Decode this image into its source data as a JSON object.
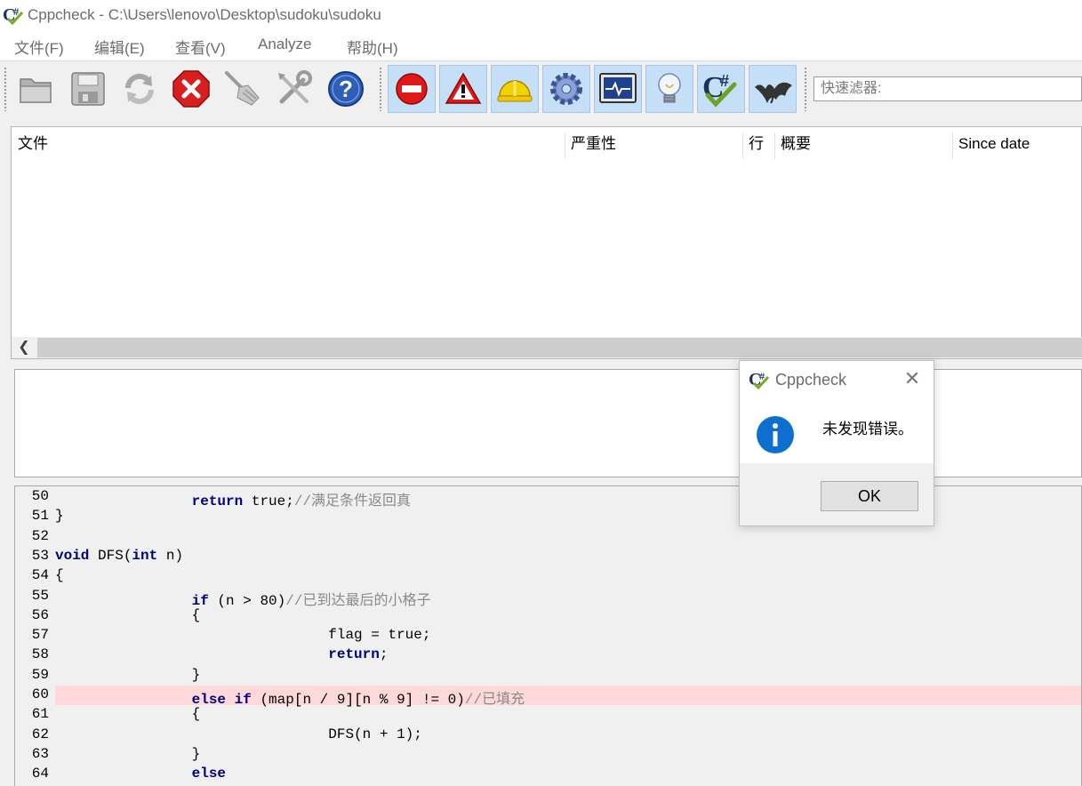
{
  "window": {
    "title": "Cppcheck - C:\\Users\\lenovo\\Desktop\\sudoku\\sudoku",
    "icon": "cppcheck-logo-icon"
  },
  "menu": [
    {
      "label": "文件(F)"
    },
    {
      "label": "编辑(E)"
    },
    {
      "label": "查看(V)"
    },
    {
      "label": "Analyze"
    },
    {
      "label": "帮助(H)"
    }
  ],
  "toolbar": {
    "buttons": [
      {
        "icon": "open-folder-icon"
      },
      {
        "icon": "save-icon"
      },
      {
        "icon": "refresh-icon"
      },
      {
        "icon": "stop-icon"
      },
      {
        "icon": "clear-broom-icon"
      },
      {
        "icon": "tools-icon"
      },
      {
        "icon": "help-icon"
      }
    ],
    "filters": [
      {
        "icon": "error-filter-icon"
      },
      {
        "icon": "warning-filter-icon"
      },
      {
        "icon": "style-filter-icon"
      },
      {
        "icon": "performance-filter-icon"
      },
      {
        "icon": "portability-filter-icon"
      },
      {
        "icon": "information-filter-icon"
      },
      {
        "icon": "cpp-standard-filter-icon"
      },
      {
        "icon": "unused-filter-icon"
      }
    ],
    "filter_placeholder": "快速滤器:"
  },
  "results": {
    "columns": [
      "文件",
      "严重性",
      "行",
      "概要",
      "Since date"
    ]
  },
  "code": {
    "lines": [
      {
        "num": "50",
        "indent": "                ",
        "parts": [
          {
            "t": "return",
            "c": "kw"
          },
          {
            "t": " true;"
          },
          {
            "t": "//满足条件返回真",
            "c": "cm"
          }
        ]
      },
      {
        "num": "51",
        "indent": "",
        "parts": [
          {
            "t": "}"
          }
        ]
      },
      {
        "num": "52",
        "indent": "",
        "parts": []
      },
      {
        "num": "53",
        "indent": "",
        "parts": [
          {
            "t": "void",
            "c": "kw"
          },
          {
            "t": " DFS("
          },
          {
            "t": "int",
            "c": "kw"
          },
          {
            "t": " n)"
          }
        ]
      },
      {
        "num": "54",
        "indent": "",
        "parts": [
          {
            "t": "{"
          }
        ]
      },
      {
        "num": "55",
        "indent": "                ",
        "parts": [
          {
            "t": "if",
            "c": "kw"
          },
          {
            "t": " (n > 80)"
          },
          {
            "t": "//已到达最后的小格子",
            "c": "cm"
          }
        ]
      },
      {
        "num": "56",
        "indent": "                ",
        "parts": [
          {
            "t": "{"
          }
        ]
      },
      {
        "num": "57",
        "indent": "                                ",
        "parts": [
          {
            "t": "flag = true;"
          }
        ]
      },
      {
        "num": "58",
        "indent": "                                ",
        "parts": [
          {
            "t": "return",
            "c": "kw"
          },
          {
            "t": ";"
          }
        ]
      },
      {
        "num": "59",
        "indent": "                ",
        "parts": [
          {
            "t": "}"
          }
        ]
      },
      {
        "num": "60",
        "indent": "                ",
        "highlight": true,
        "parts": [
          {
            "t": "else",
            "c": "kw"
          },
          {
            "t": " "
          },
          {
            "t": "if",
            "c": "kw"
          },
          {
            "t": " (map[n / 9][n % 9] != 0)"
          },
          {
            "t": "//已填充",
            "c": "cm"
          }
        ]
      },
      {
        "num": "61",
        "indent": "                ",
        "parts": [
          {
            "t": "{"
          }
        ]
      },
      {
        "num": "62",
        "indent": "                                ",
        "parts": [
          {
            "t": "DFS(n + 1);"
          }
        ]
      },
      {
        "num": "63",
        "indent": "                ",
        "parts": [
          {
            "t": "}"
          }
        ]
      },
      {
        "num": "64",
        "indent": "                ",
        "parts": [
          {
            "t": "else",
            "c": "kw"
          }
        ]
      }
    ]
  },
  "dialog": {
    "title": "Cppcheck",
    "message": "未发现错误。",
    "ok_label": "OK",
    "icon": "information-icon"
  },
  "colors": {
    "highlight_line": "#ffd9d9",
    "toolbar_checked": "#c5dff7",
    "keyword": "#000080",
    "comment": "#8a8a8a"
  }
}
